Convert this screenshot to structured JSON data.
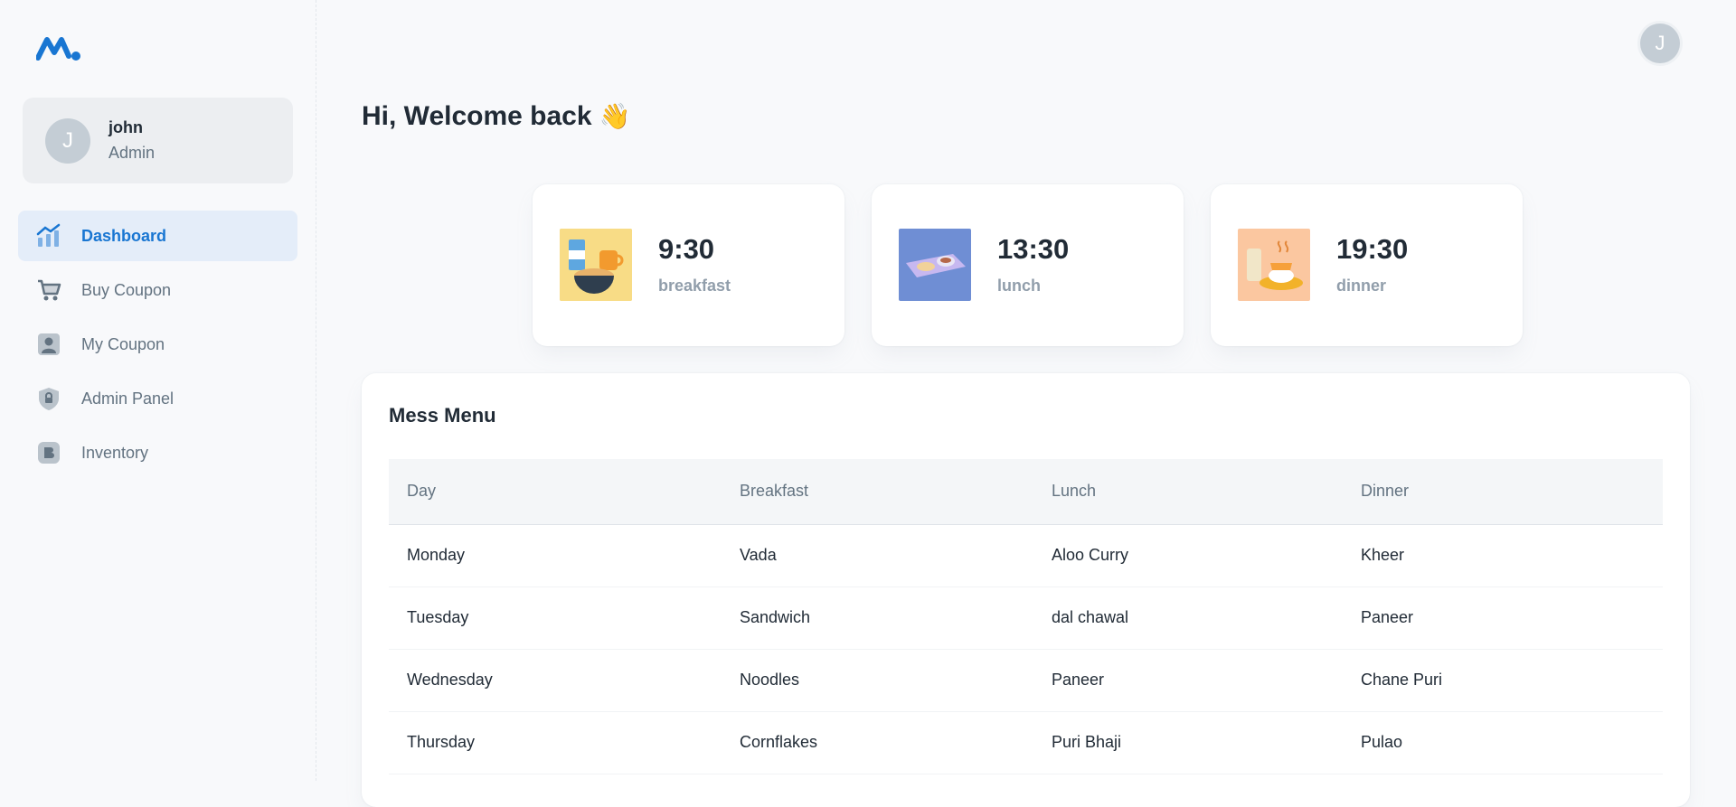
{
  "account": {
    "initial": "J",
    "name": "john",
    "role": "Admin"
  },
  "nav": [
    {
      "label": "Dashboard",
      "icon": "chart-icon",
      "active": true
    },
    {
      "label": "Buy Coupon",
      "icon": "cart-icon",
      "active": false
    },
    {
      "label": "My Coupon",
      "icon": "user-card-icon",
      "active": false
    },
    {
      "label": "Admin Panel",
      "icon": "lock-shield-icon",
      "active": false
    },
    {
      "label": "Inventory",
      "icon": "inventory-icon",
      "active": false
    }
  ],
  "topbar": {
    "avatar_initial": "J"
  },
  "greeting": {
    "text": "Hi, Welcome back",
    "emoji": "👋"
  },
  "meals": [
    {
      "time": "9:30",
      "label": "breakfast",
      "bg": "#f7d77d"
    },
    {
      "time": "13:30",
      "label": "lunch",
      "bg": "#6f8ed4"
    },
    {
      "time": "19:30",
      "label": "dinner",
      "bg": "#f8c8a2"
    }
  ],
  "menu": {
    "title": "Mess Menu",
    "columns": [
      "Day",
      "Breakfast",
      "Lunch",
      "Dinner"
    ],
    "rows": [
      [
        "Monday",
        "Vada",
        "Aloo Curry",
        "Kheer"
      ],
      [
        "Tuesday",
        "Sandwich",
        "dal chawal",
        "Paneer"
      ],
      [
        "Wednesday",
        "Noodles",
        "Paneer",
        "Chane Puri"
      ],
      [
        "Thursday",
        "Cornflakes",
        "Puri Bhaji",
        "Pulao"
      ]
    ]
  },
  "colors": {
    "accent": "#1976d2",
    "active_bg": "#e4edf9"
  }
}
